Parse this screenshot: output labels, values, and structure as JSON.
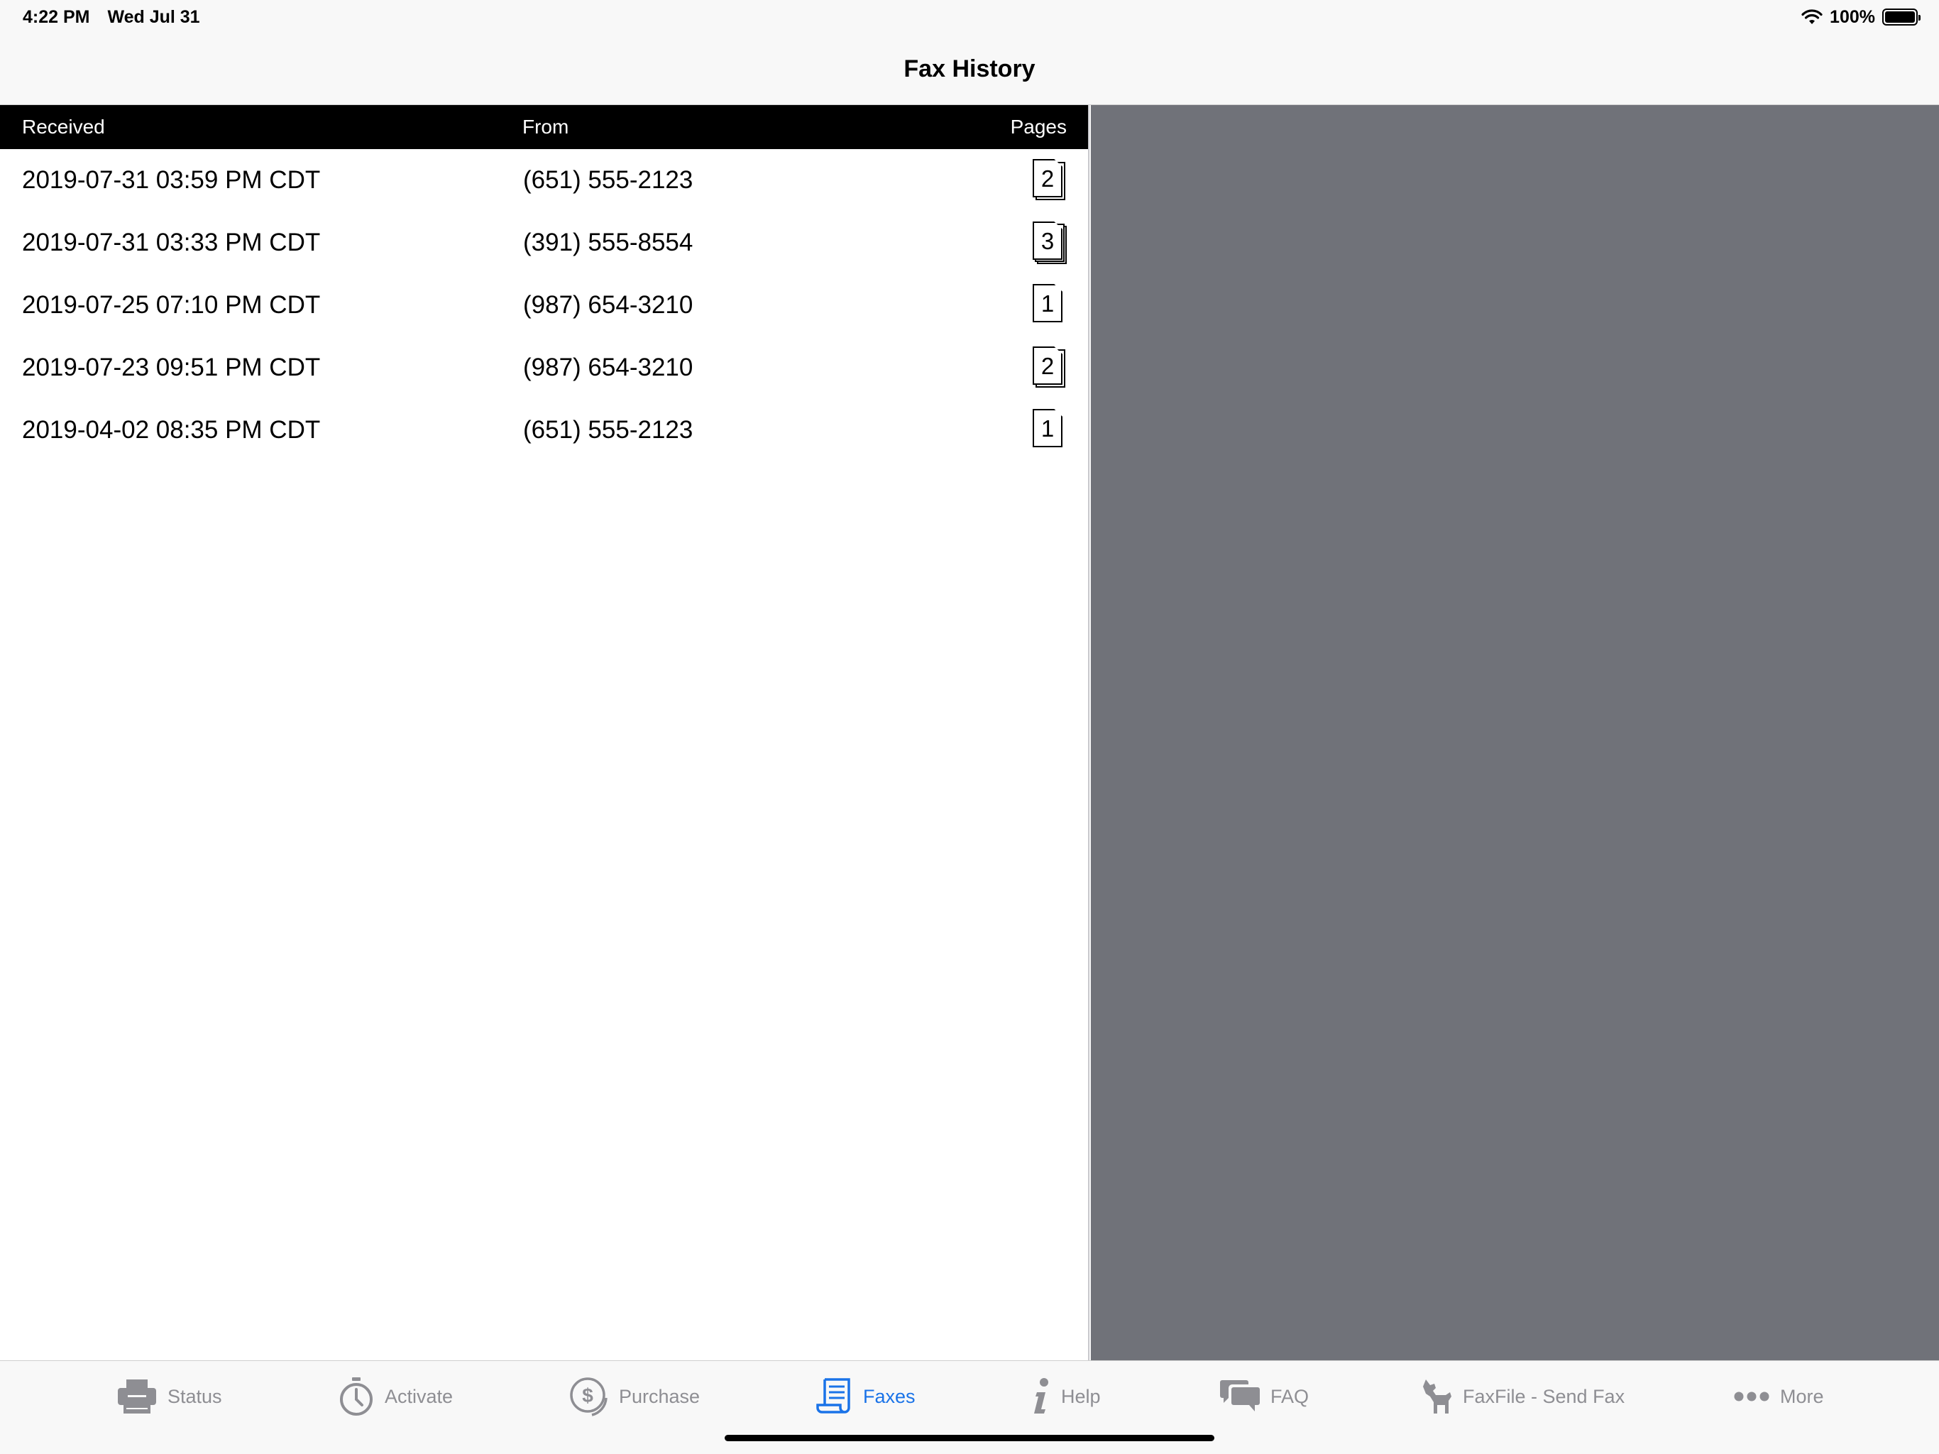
{
  "status_bar": {
    "time": "4:22 PM",
    "date": "Wed Jul 31",
    "battery_percent": "100%"
  },
  "nav": {
    "title": "Fax History"
  },
  "table": {
    "headers": {
      "received": "Received",
      "from": "From",
      "pages": "Pages"
    },
    "rows": [
      {
        "received": "2019-07-31 03:59 PM CDT",
        "from": "(651) 555-2123",
        "pages": "2"
      },
      {
        "received": "2019-07-31 03:33 PM CDT",
        "from": "(391) 555-8554",
        "pages": "3"
      },
      {
        "received": "2019-07-25 07:10 PM CDT",
        "from": "(987) 654-3210",
        "pages": "1"
      },
      {
        "received": "2019-07-23 09:51 PM CDT",
        "from": "(987) 654-3210",
        "pages": "2"
      },
      {
        "received": "2019-04-02 08:35 PM CDT",
        "from": "(651) 555-2123",
        "pages": "1"
      }
    ]
  },
  "tabs": [
    {
      "label": "Status",
      "icon": "fax-machine-icon",
      "active": false
    },
    {
      "label": "Activate",
      "icon": "stopwatch-icon",
      "active": false
    },
    {
      "label": "Purchase",
      "icon": "dollar-coin-icon",
      "active": false
    },
    {
      "label": "Faxes",
      "icon": "scroll-document-icon",
      "active": true
    },
    {
      "label": "Help",
      "icon": "info-icon",
      "active": false
    },
    {
      "label": "FAQ",
      "icon": "chat-bubbles-icon",
      "active": false
    },
    {
      "label": "FaxFile - Send Fax",
      "icon": "dog-icon",
      "active": false
    },
    {
      "label": "More",
      "icon": "more-dots-icon",
      "active": false
    }
  ],
  "colors": {
    "accent": "#1a73e8",
    "inactive_tab": "#8e8e93",
    "header_bg": "#000000",
    "detail_bg": "#707279"
  }
}
